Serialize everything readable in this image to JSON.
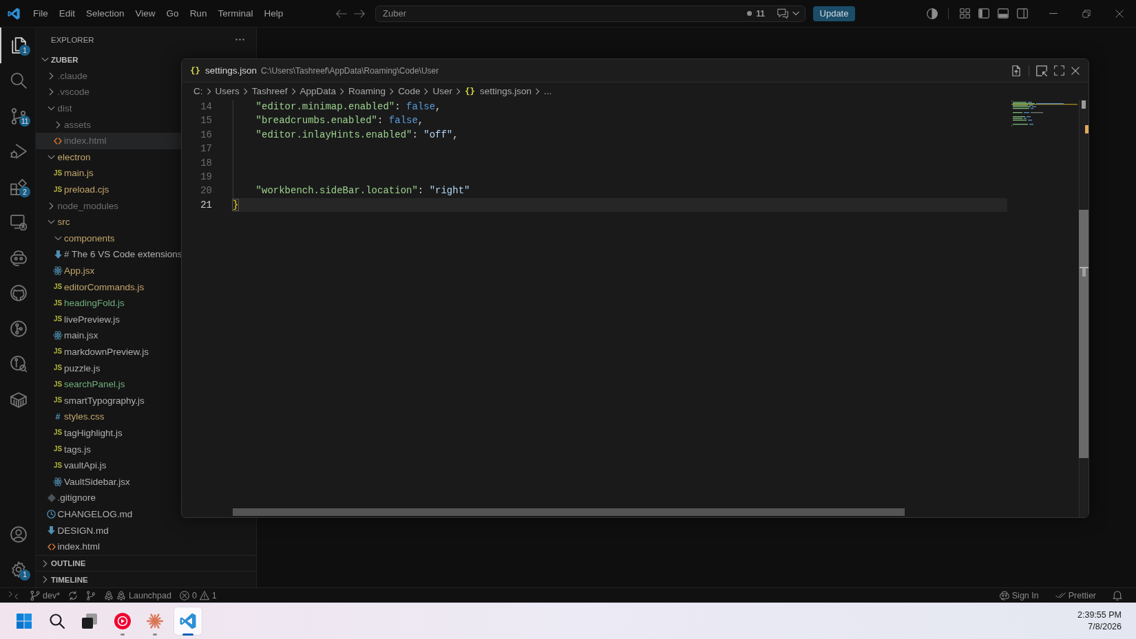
{
  "title_bar": {
    "menu": [
      "File",
      "Edit",
      "Selection",
      "View",
      "Go",
      "Run",
      "Terminal",
      "Help"
    ],
    "command_center": {
      "label": "Zuber",
      "changes": "11"
    },
    "update_button": "Update"
  },
  "activity_bar": {
    "items": [
      {
        "kind": "explorer",
        "selected": true,
        "badge": "1"
      },
      {
        "kind": "search",
        "selected": false
      },
      {
        "kind": "source-control",
        "selected": false,
        "badge": "11"
      },
      {
        "kind": "run-debug",
        "selected": false
      },
      {
        "kind": "extensions",
        "selected": false,
        "badge": "2"
      },
      {
        "kind": "remote",
        "selected": false
      },
      {
        "kind": "robot",
        "selected": false
      },
      {
        "kind": "github",
        "selected": false
      },
      {
        "kind": "git-graph",
        "selected": false
      },
      {
        "kind": "git-search",
        "selected": false
      },
      {
        "kind": "box",
        "selected": false
      }
    ],
    "bottom_items": [
      {
        "kind": "account"
      },
      {
        "kind": "settings",
        "badge": "1"
      }
    ]
  },
  "sidebar": {
    "title": "EXPLORER",
    "root": {
      "label": "ZUBER",
      "expanded": true,
      "children": [
        {
          "label": ".claude",
          "kind": "folder",
          "expanded": false,
          "color": "#6e6e6e",
          "selected": false
        },
        {
          "label": ".vscode",
          "kind": "folder",
          "expanded": false,
          "color": "#6e6e6e",
          "selected": false
        },
        {
          "label": "dist",
          "kind": "folder",
          "expanded": true,
          "color": "#6e6e6e",
          "selected": false,
          "children": [
            {
              "label": "assets",
              "kind": "folder",
              "expanded": false,
              "color": "#6e6e6e",
              "selected": false
            },
            {
              "label": "index.html",
              "kind": "html",
              "color": "#6e6e6e",
              "selected": true
            }
          ]
        },
        {
          "label": "electron",
          "kind": "folder",
          "expanded": true,
          "color": "#c4a66c",
          "selected": false,
          "children": [
            {
              "label": "main.js",
              "kind": "js",
              "glyph": "JS",
              "color": "#c4a66c",
              "selected": false
            },
            {
              "label": "preload.cjs",
              "kind": "js",
              "glyph": "JS",
              "color": "#c4a66c",
              "selected": false
            }
          ]
        },
        {
          "label": "node_modules",
          "kind": "folder",
          "expanded": false,
          "color": "#6e6e6e",
          "selected": false
        },
        {
          "label": "src",
          "kind": "folder",
          "expanded": true,
          "color": "#c4a66c",
          "selected": false,
          "children": [
            {
              "label": "components",
              "kind": "folder",
              "expanded": true,
              "color": "#c4a66c",
              "selected": false
            },
            {
              "label": "# The 6 VS Code extensions",
              "kind": "markdown",
              "color": "#b0b0b0",
              "selected": false
            },
            {
              "label": "App.jsx",
              "kind": "react",
              "color": "#c4a66c",
              "selected": false
            },
            {
              "label": "editorCommands.js",
              "kind": "js",
              "glyph": "JS",
              "color": "#c4a66c",
              "selected": false
            },
            {
              "label": "headingFold.js",
              "kind": "js",
              "glyph": "JS",
              "color": "#6fae7c",
              "selected": false
            },
            {
              "label": "livePreview.js",
              "kind": "js",
              "glyph": "JS",
              "color": "#b0b0b0",
              "selected": false
            },
            {
              "label": "main.jsx",
              "kind": "react",
              "color": "#b0b0b0",
              "selected": false
            },
            {
              "label": "markdownPreview.js",
              "kind": "js",
              "glyph": "JS",
              "color": "#b0b0b0",
              "selected": false
            },
            {
              "label": "puzzle.js",
              "kind": "js",
              "glyph": "JS",
              "color": "#b0b0b0",
              "selected": false
            },
            {
              "label": "searchPanel.js",
              "kind": "js",
              "glyph": "JS",
              "color": "#6fae7c",
              "selected": false
            },
            {
              "label": "smartTypography.js",
              "kind": "js",
              "glyph": "JS",
              "color": "#b0b0b0",
              "selected": false
            },
            {
              "label": "styles.css",
              "kind": "css",
              "glyph": "#",
              "color": "#c4a66c",
              "selected": false
            },
            {
              "label": "tagHighlight.js",
              "kind": "js",
              "glyph": "JS",
              "color": "#b0b0b0",
              "selected": false
            },
            {
              "label": "tags.js",
              "kind": "js",
              "glyph": "JS",
              "color": "#b0b0b0",
              "selected": false
            },
            {
              "label": "vaultApi.js",
              "kind": "js",
              "glyph": "JS",
              "color": "#b0b0b0",
              "selected": false
            },
            {
              "label": "VaultSidebar.jsx",
              "kind": "react",
              "color": "#b0b0b0",
              "selected": false
            }
          ]
        },
        {
          "label": ".gitignore",
          "kind": "gitignore",
          "color": "#b0b0b0",
          "selected": false
        },
        {
          "label": "CHANGELOG.md",
          "kind": "changelog",
          "color": "#b0b0b0",
          "selected": false
        },
        {
          "label": "DESIGN.md",
          "kind": "markdown",
          "color": "#b0b0b0",
          "selected": false
        },
        {
          "label": "index.html",
          "kind": "html",
          "color": "#b0b0b0",
          "selected": false
        }
      ]
    },
    "sections": [
      {
        "label": "OUTLINE",
        "expanded": false
      },
      {
        "label": "TIMELINE",
        "expanded": false
      }
    ]
  },
  "editor": {
    "file_icon": "{}",
    "title": "settings.json",
    "path": "C:\\Users\\Tashreef\\AppData\\Roaming\\Code\\User",
    "breadcrumbs": [
      {
        "label": "C:"
      },
      {
        "label": "Users"
      },
      {
        "label": "Tashreef"
      },
      {
        "label": "AppData"
      },
      {
        "label": "Roaming"
      },
      {
        "label": "Code"
      },
      {
        "label": "User"
      },
      {
        "label": "settings.json",
        "icon": "{}"
      },
      {
        "label": "..."
      }
    ],
    "lines": [
      {
        "number": "14",
        "current": false,
        "indented": true,
        "tokens": [
          {
            "kind": "key",
            "text": "\"editor.minimap.enabled\""
          },
          {
            "kind": "punct",
            "text": ": "
          },
          {
            "kind": "keyword",
            "text": "false"
          },
          {
            "kind": "punct",
            "text": ","
          }
        ]
      },
      {
        "number": "15",
        "current": false,
        "indented": true,
        "tokens": [
          {
            "kind": "key",
            "text": "\"breadcrumbs.enabled\""
          },
          {
            "kind": "punct",
            "text": ": "
          },
          {
            "kind": "keyword",
            "text": "false"
          },
          {
            "kind": "punct",
            "text": ","
          }
        ]
      },
      {
        "number": "16",
        "current": false,
        "indented": true,
        "tokens": [
          {
            "kind": "key",
            "text": "\"editor.inlayHints.enabled\""
          },
          {
            "kind": "punct",
            "text": ": "
          },
          {
            "kind": "string",
            "text": "\"off\""
          },
          {
            "kind": "punct",
            "text": ","
          }
        ]
      },
      {
        "number": "17",
        "current": false,
        "indented": true
      },
      {
        "number": "18",
        "current": false,
        "indented": true
      },
      {
        "number": "19",
        "current": false,
        "indented": true
      },
      {
        "number": "20",
        "current": false,
        "indented": true,
        "tokens": [
          {
            "kind": "key",
            "text": "\"workbench.sideBar.location\""
          },
          {
            "kind": "punct",
            "text": ": "
          },
          {
            "kind": "string",
            "text": "\"right\""
          }
        ]
      },
      {
        "number": "21",
        "current": true,
        "indented": false,
        "tokens": [
          {
            "kind": "bracket",
            "text": "}"
          }
        ]
      }
    ]
  },
  "status_bar": {
    "left": [
      {
        "kind": "remote"
      },
      {
        "kind": "branch",
        "text": "dev*"
      },
      {
        "kind": "sync"
      },
      {
        "kind": "git-graph"
      },
      {
        "kind": "launchpad",
        "text": "Launchpad"
      },
      {
        "kind": "problems",
        "errors": "0",
        "warnings": "1"
      }
    ],
    "right": [
      {
        "kind": "sign-in",
        "text": "Sign In"
      },
      {
        "kind": "prettier",
        "text": "Prettier"
      },
      {
        "kind": "notifications"
      }
    ]
  },
  "taskbar": {
    "apps": [
      {
        "kind": "start",
        "running": false,
        "active": false
      },
      {
        "kind": "search",
        "running": false,
        "active": false
      },
      {
        "kind": "task-view",
        "running": false,
        "active": false
      },
      {
        "kind": "music",
        "running": true,
        "active": false
      },
      {
        "kind": "claude",
        "running": true,
        "active": false
      },
      {
        "kind": "vscode",
        "running": true,
        "active": true
      }
    ],
    "clock": {
      "time": "2:39:55 PM",
      "date": "7/8/2026"
    }
  }
}
